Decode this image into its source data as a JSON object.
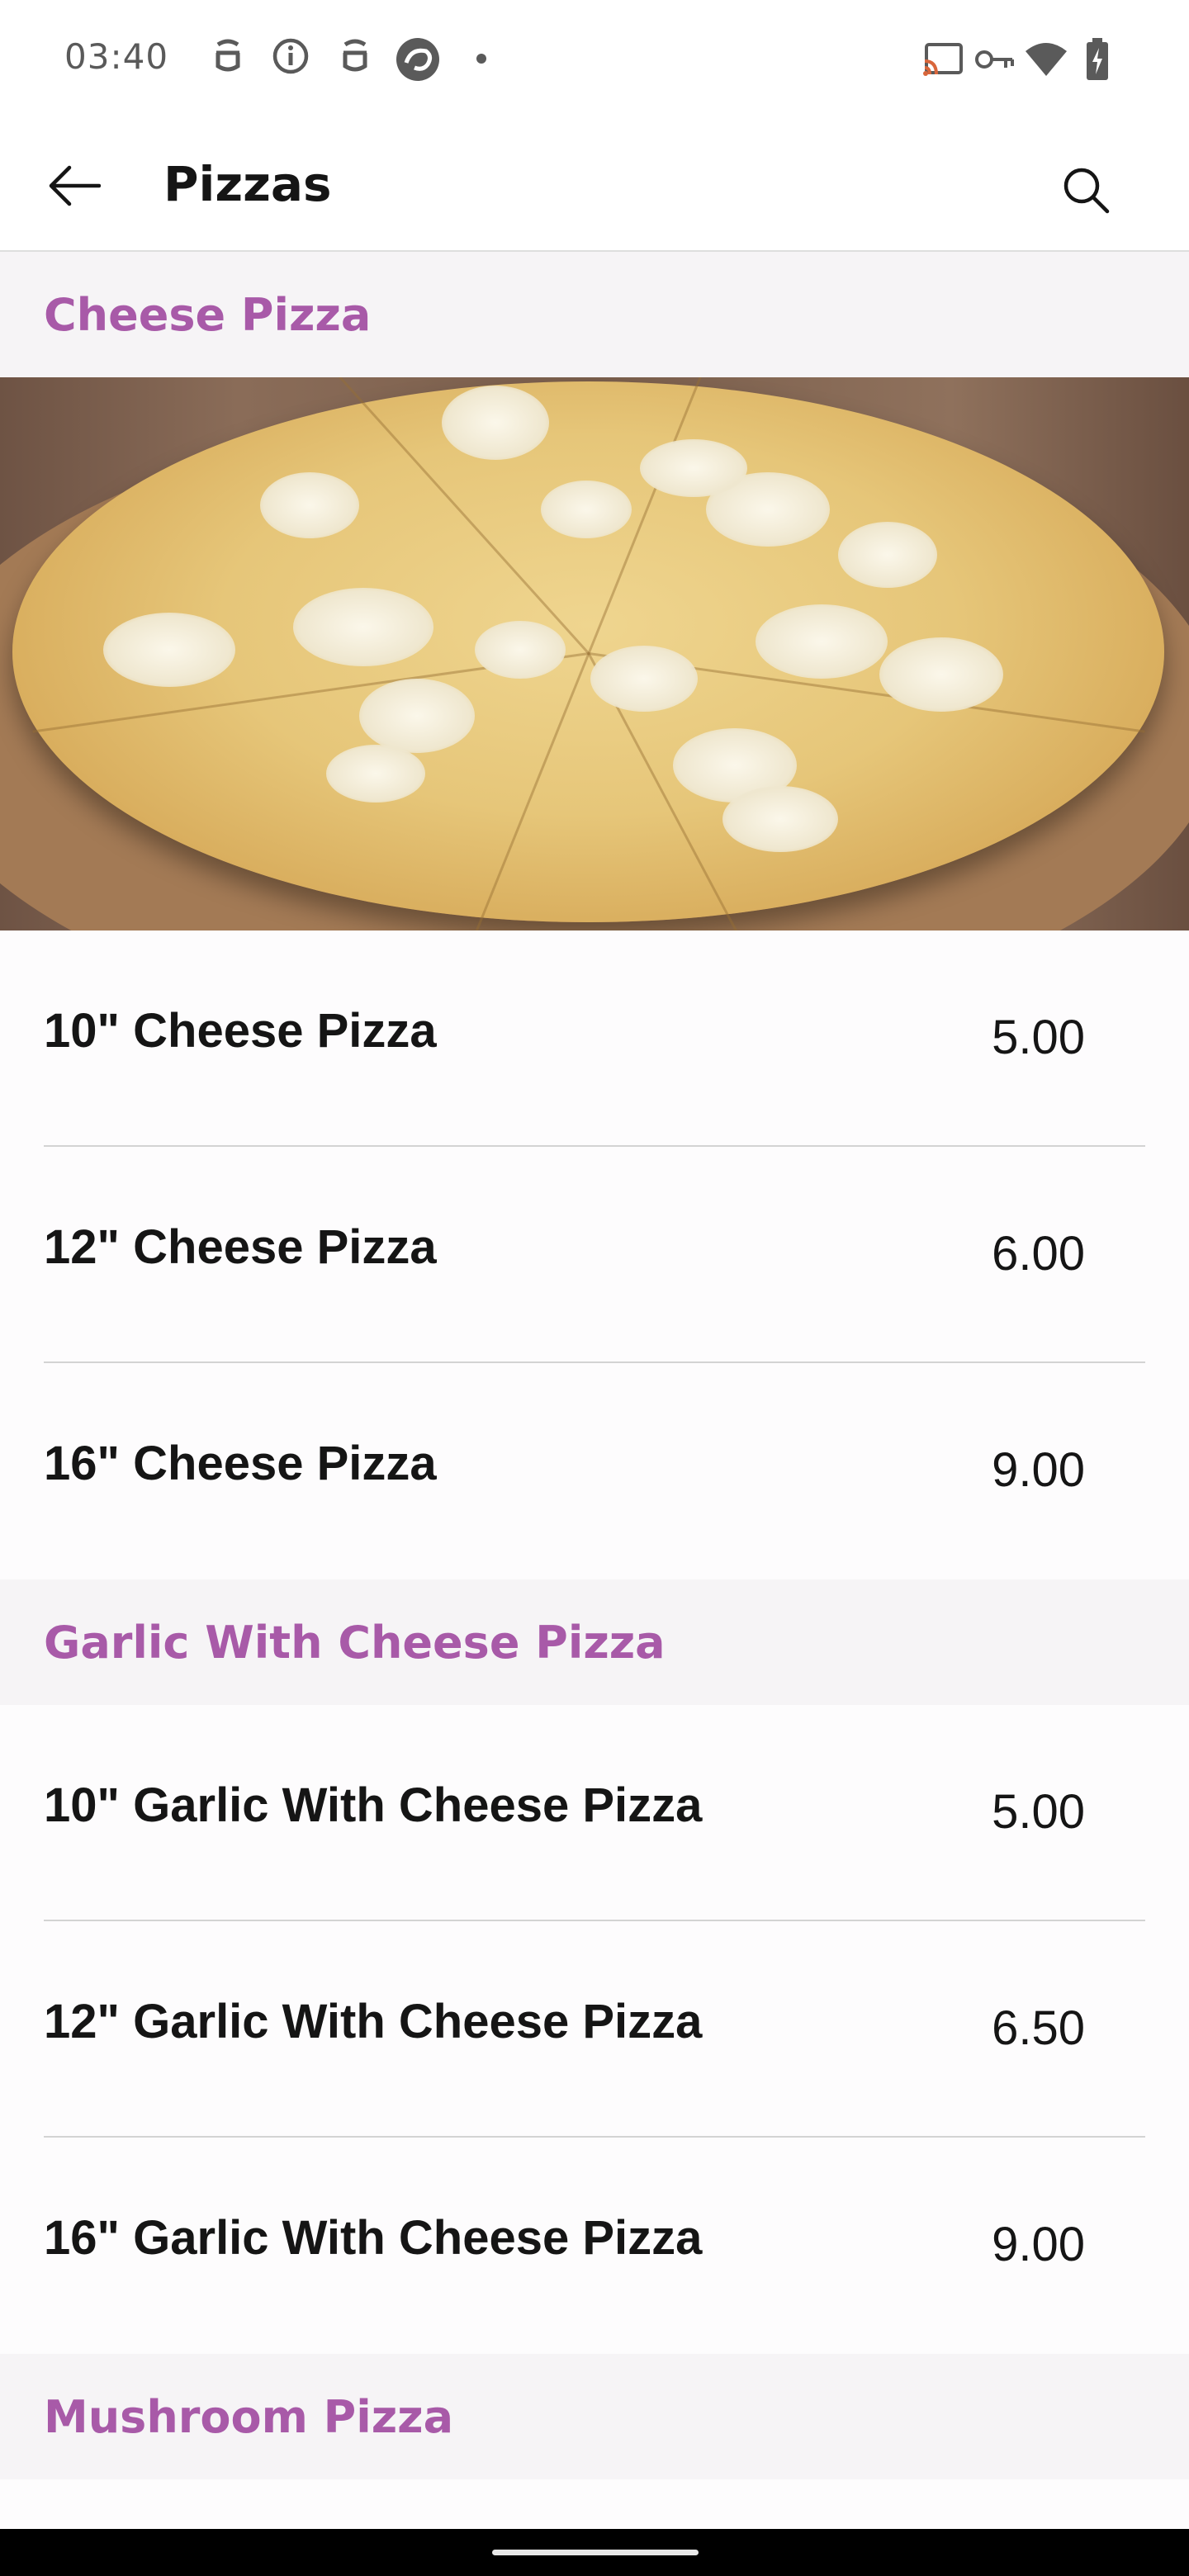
{
  "status_bar": {
    "time": "03:40",
    "left_icons": [
      "notification-app-icon",
      "info-icon",
      "notification-app-icon",
      "browser-app-icon",
      "dot-icon"
    ],
    "right_icons": [
      "cast-icon",
      "vpn-key-icon",
      "wifi-icon",
      "battery-charging-icon"
    ]
  },
  "header": {
    "title": "Pizzas",
    "back_icon": "arrow-left-icon",
    "search_icon": "search-icon"
  },
  "sections": [
    {
      "title": "Cheese Pizza",
      "has_image": true,
      "items": [
        {
          "name": "10\" Cheese Pizza",
          "price": "5.00"
        },
        {
          "name": "12\" Cheese Pizza",
          "price": "6.00"
        },
        {
          "name": "16\" Cheese Pizza",
          "price": "9.00"
        }
      ]
    },
    {
      "title": "Garlic With Cheese Pizza",
      "has_image": false,
      "items": [
        {
          "name": "10\" Garlic With Cheese Pizza",
          "price": "5.00"
        },
        {
          "name": "12\" Garlic With Cheese Pizza",
          "price": "6.50"
        },
        {
          "name": "16\" Garlic With Cheese Pizza",
          "price": "9.00"
        }
      ]
    },
    {
      "title": "Mushroom Pizza",
      "has_image": false,
      "items": []
    }
  ],
  "colors": {
    "section_title": "#a85aa8",
    "section_bg": "#f6f4f6",
    "divider": "#d3d3d3"
  }
}
